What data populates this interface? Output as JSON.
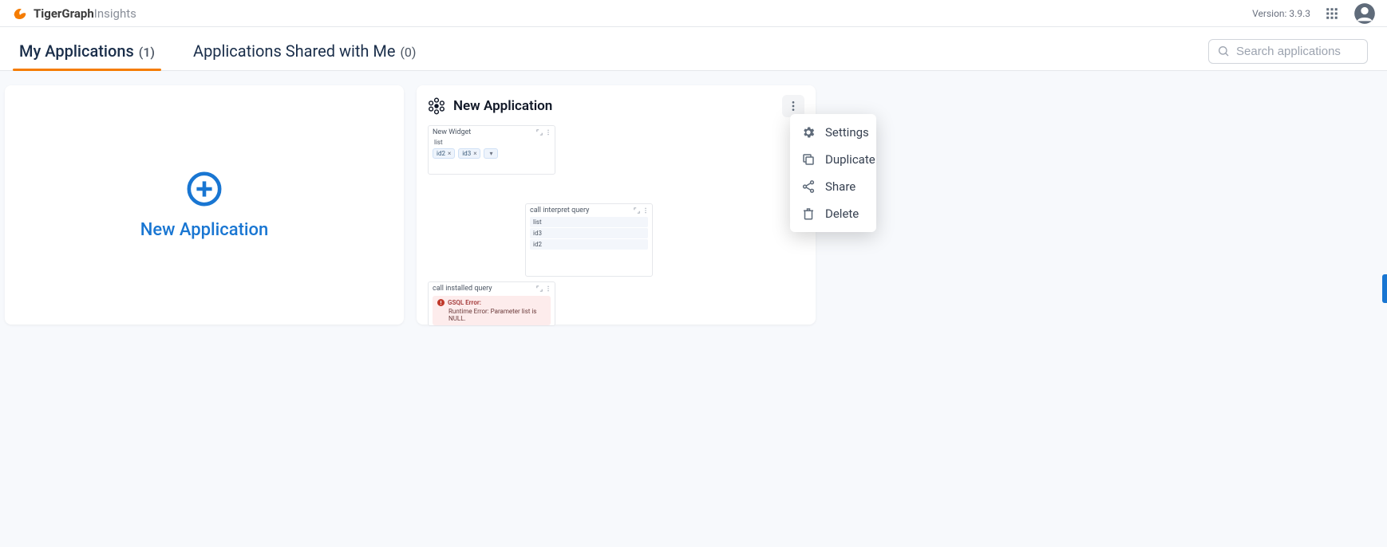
{
  "header": {
    "brand_main": "TigerGraph",
    "brand_sub": "Insights",
    "version_label": "Version: 3.9.3"
  },
  "tabs": {
    "my_apps_label": "My Applications",
    "my_apps_count": "(1)",
    "shared_label": "Applications Shared with Me",
    "shared_count": "(0)"
  },
  "search": {
    "placeholder": "Search applications"
  },
  "new_app_card": {
    "label": "New Application"
  },
  "app_card": {
    "title": "New Application",
    "preview": {
      "widget1_title": "New Widget",
      "widget1_sub": "list",
      "chip1": "id2",
      "chip2": "id3",
      "widget2_title": "call interpret query",
      "widget2_row1": "list",
      "widget2_row2": "id3",
      "widget2_row3": "id2",
      "widget3_title": "call installed query",
      "error_title": "GSQL Error:",
      "error_detail": "Runtime Error: Parameter list is NULL."
    }
  },
  "context_menu": {
    "settings": "Settings",
    "duplicate": "Duplicate",
    "share": "Share",
    "delete": "Delete"
  }
}
